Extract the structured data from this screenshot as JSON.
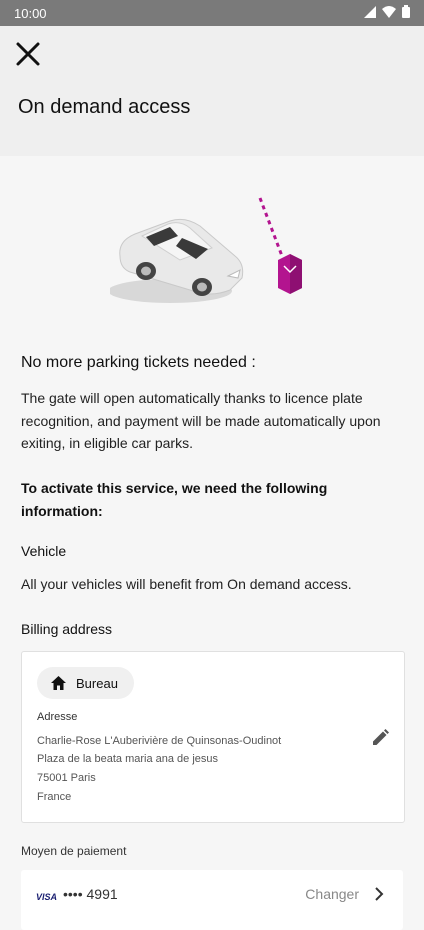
{
  "status": {
    "time": "10:00"
  },
  "header": {
    "title": "On demand access"
  },
  "intro": {
    "heading": "No more parking tickets needed :",
    "description": "The gate will open automatically thanks to licence plate recognition, and payment will be made automatically upon exiting, in eligible car parks.",
    "requirements_heading": "To activate this service, we need the following information:"
  },
  "vehicle": {
    "label": "Vehicle",
    "description": "All your vehicles will benefit from On demand access."
  },
  "billing": {
    "label": "Billing address",
    "chip_label": "Bureau",
    "address_label": "Adresse",
    "lines": [
      "Charlie-Rose L'Auberivière de Quinsonas-Oudinot",
      "Plaza de la beata maria ana de jesus",
      "75001 Paris",
      "France"
    ]
  },
  "payment": {
    "label": "Moyen de paiement",
    "brand": "VISA",
    "masked_number": "•••• 4991",
    "change_label": "Changer"
  },
  "colors": {
    "accent": "#b3148f"
  },
  "icons": [
    "signal-icon",
    "wifi-icon",
    "battery-icon",
    "close-icon",
    "home-icon",
    "pencil-icon",
    "chevron-right-icon"
  ]
}
